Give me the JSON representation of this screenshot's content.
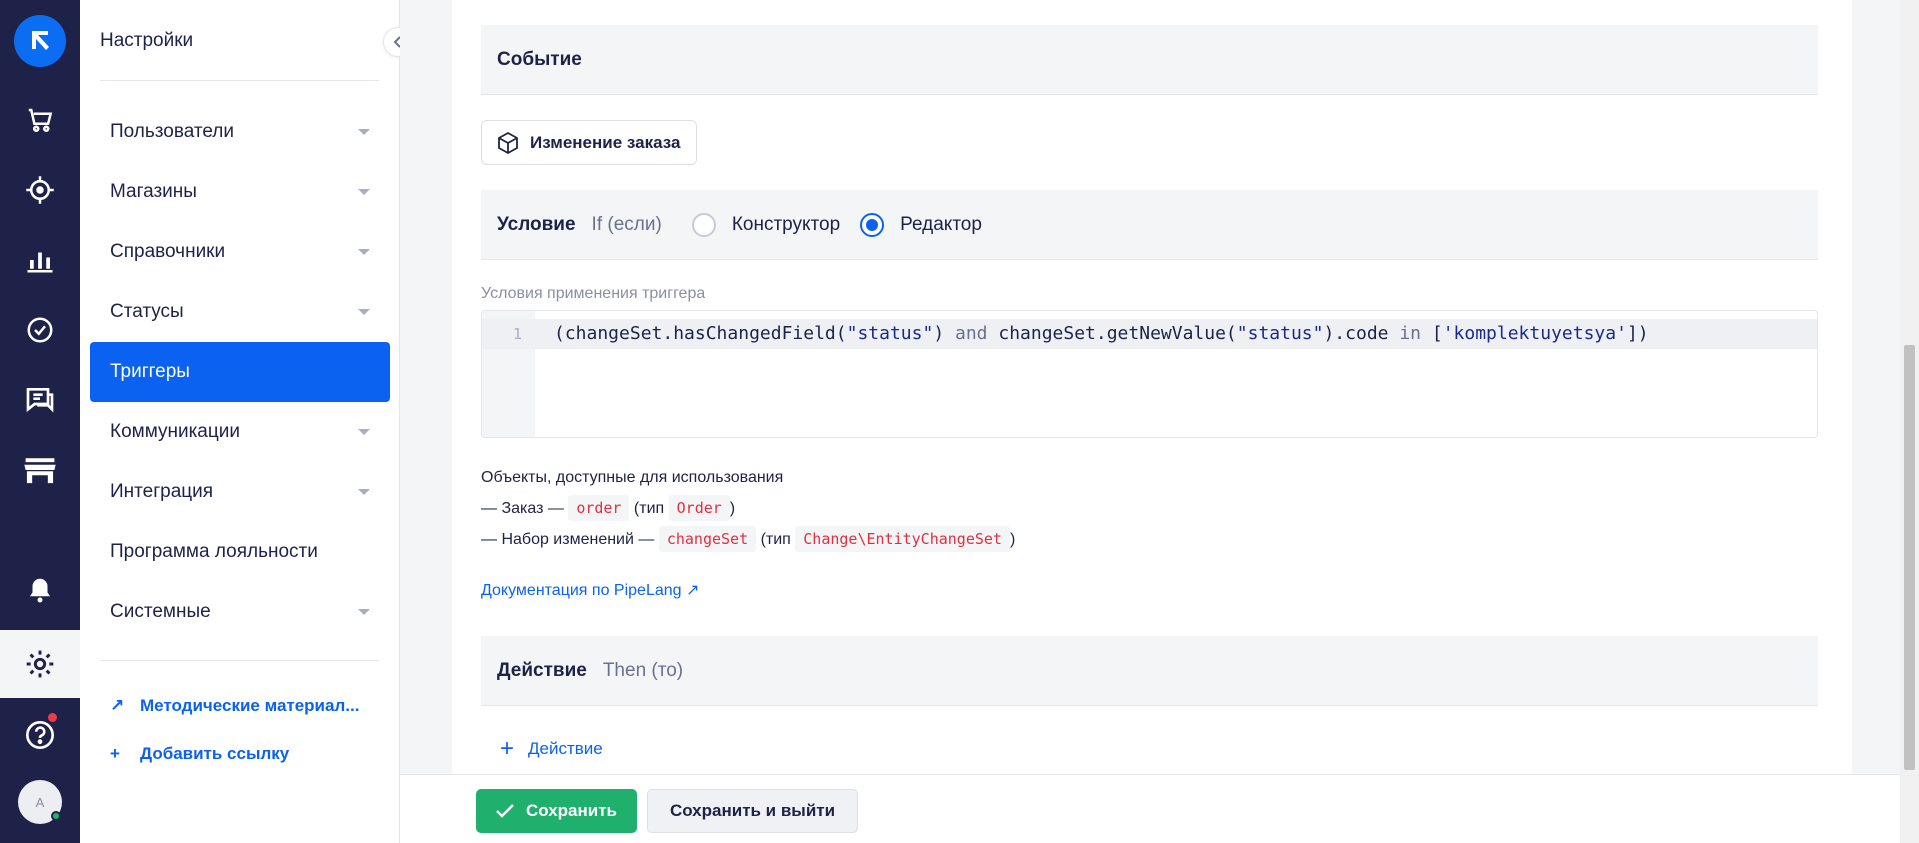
{
  "sidebar": {
    "title": "Настройки",
    "items": [
      {
        "label": "Пользователи",
        "has_caret": true
      },
      {
        "label": "Магазины",
        "has_caret": true
      },
      {
        "label": "Справочники",
        "has_caret": true
      },
      {
        "label": "Статусы",
        "has_caret": true
      },
      {
        "label": "Триггеры",
        "active": true
      },
      {
        "label": "Коммуникации",
        "has_caret": true
      },
      {
        "label": "Интеграция",
        "has_caret": true
      },
      {
        "label": "Программа лояльности"
      },
      {
        "label": "Системные",
        "has_caret": true
      }
    ],
    "links": [
      {
        "prefix": "↗",
        "label": "Методические материал..."
      },
      {
        "prefix": "+",
        "label": "Добавить ссылку"
      }
    ]
  },
  "rail": {
    "icons": [
      "cart-icon",
      "target-icon",
      "analytics-icon",
      "tasks-icon",
      "chat-icon",
      "store-icon",
      "bell-icon",
      "gear-icon",
      "help-icon"
    ],
    "avatar_initial": "A"
  },
  "event": {
    "heading": "Событие",
    "chip_label": "Изменение заказа"
  },
  "condition": {
    "heading": "Условие",
    "sub": "If (если)",
    "options": [
      "Конструктор",
      "Редактор"
    ],
    "selected": "Редактор",
    "editor_label": "Условия применения триггера",
    "line_number": "1",
    "code": {
      "p1": "(changeSet.hasChangedField(",
      "s1": "\"status\"",
      "p2": ") ",
      "k1": "and",
      "p3": " changeSet.getNewValue(",
      "s2": "\"status\"",
      "p4": ").code ",
      "k2": "in",
      "p5": " [",
      "s3": "'komplektuyetsya'",
      "p6": "])"
    }
  },
  "objects": {
    "title": "Объекты, доступные для использования",
    "rows": [
      {
        "prefix": "— Заказ —",
        "var": "order",
        "type_prefix": "(тип",
        "type": "Order",
        "suffix": ")"
      },
      {
        "prefix": "— Набор изменений —",
        "var": "changeSet",
        "type_prefix": "(тип",
        "type": "Change\\EntityChangeSet",
        "suffix": ")"
      }
    ]
  },
  "doc_link": "Документация по PipeLang ↗",
  "action": {
    "heading": "Действие",
    "sub": "Then (то)",
    "add_label": "Действие"
  },
  "footer": {
    "save": "Сохранить",
    "save_exit": "Сохранить и выйти"
  },
  "colors": {
    "rail_bg": "#1e2248",
    "accent": "#0b62f0",
    "save_green": "#20b06e",
    "code_tag_red": "#e0303f"
  }
}
